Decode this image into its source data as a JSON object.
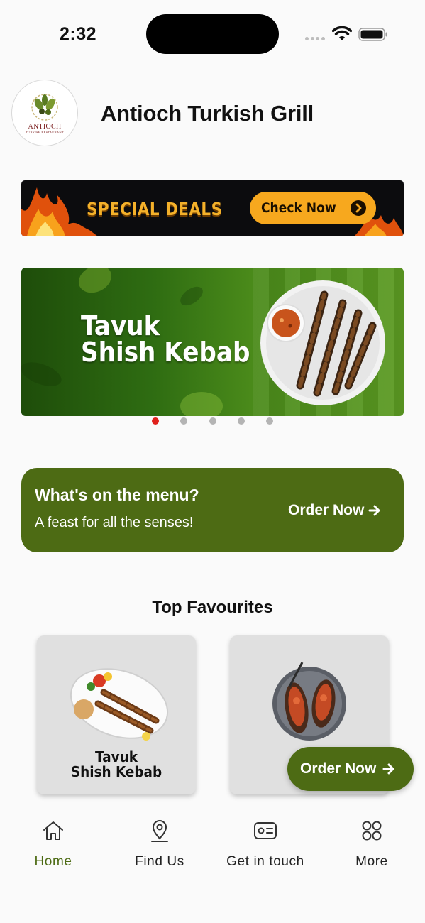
{
  "status_bar": {
    "time": "2:32"
  },
  "header": {
    "logo_text": "ANTIOCH",
    "logo_subtext": "TURKISH RESTAURANT",
    "title": "Antioch Turkish Grill"
  },
  "deals_banner": {
    "text": "SPECIAL DEALS",
    "button_label": "Check Now"
  },
  "hero": {
    "title_line1": "Tavuk",
    "title_line2": "Shish Kebab",
    "slide_count": 5,
    "active_slide": 1
  },
  "menu_cta": {
    "title": "What's on the menu?",
    "subtitle": "A feast for all the senses!",
    "button_label": "Order Now"
  },
  "favourites": {
    "heading": "Top Favourites",
    "items": [
      {
        "name_line1": "Tavuk",
        "name_line2": "Shish Kebab"
      },
      {
        "name_line1": "",
        "name_line2": ""
      }
    ]
  },
  "fab": {
    "label": "Order Now"
  },
  "bottom_nav": {
    "items": [
      {
        "label": "Home",
        "icon": "home-icon",
        "active": true
      },
      {
        "label": "Find Us",
        "icon": "location-pin-icon",
        "active": false
      },
      {
        "label": "Get in touch",
        "icon": "contact-card-icon",
        "active": false
      },
      {
        "label": "More",
        "icon": "grid-icon",
        "active": false
      }
    ]
  },
  "colors": {
    "brand_green": "#4d6b14",
    "active_dot": "#e0201b",
    "deal_orange": "#f7a81e"
  }
}
